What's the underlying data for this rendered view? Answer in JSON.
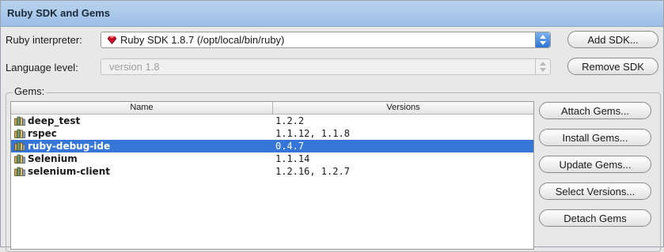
{
  "panel": {
    "title": "Ruby SDK and Gems"
  },
  "interpreter": {
    "label": "Ruby interpreter:",
    "value": "Ruby SDK 1.8.7 (/opt/local/bin/ruby)",
    "add_sdk_label": "Add SDK..."
  },
  "language": {
    "label": "Language level:",
    "value": "version 1.8",
    "remove_sdk_label": "Remove SDK"
  },
  "gems": {
    "group_label": "Gems:",
    "columns": [
      "Name",
      "Versions"
    ],
    "rows": [
      {
        "name": "deep_test",
        "versions": "1.2.2",
        "selected": false
      },
      {
        "name": "rspec",
        "versions": "1.1.12, 1.1.8",
        "selected": false
      },
      {
        "name": "ruby-debug-ide",
        "versions": "0.4.7",
        "selected": true
      },
      {
        "name": "Selenium",
        "versions": "1.1.14",
        "selected": false
      },
      {
        "name": "selenium-client",
        "versions": "1.2.16, 1.2.7",
        "selected": false
      }
    ],
    "buttons": {
      "attach": "Attach Gems...",
      "install": "Install Gems...",
      "update": "Update Gems...",
      "select_versions": "Select Versions...",
      "detach": "Detach Gems"
    }
  },
  "icons": {
    "interpreter": "ruby-gem-icon",
    "gem_row": "gem-jar-icon"
  },
  "colors": {
    "titlebar": "#9dbfe6",
    "selection": "#3676d6",
    "ruby_red": "#c8102e"
  }
}
